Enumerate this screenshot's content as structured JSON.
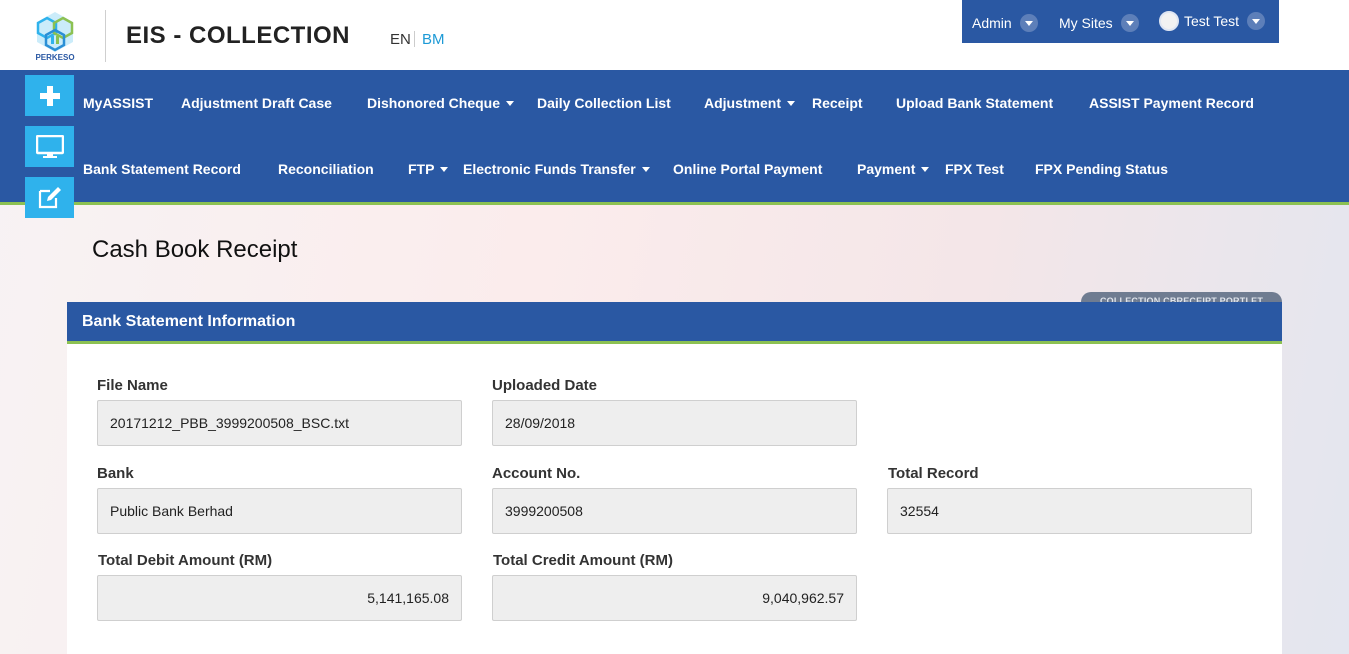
{
  "header": {
    "logo_text": "PERKESO",
    "app_title": "EIS - COLLECTION",
    "lang_en": "EN",
    "lang_bm": "BM"
  },
  "topbar": {
    "admin": "Admin",
    "my_sites": "My Sites",
    "user": "Test Test"
  },
  "nav": {
    "row1": [
      {
        "label": "MyASSIST",
        "dropdown": false
      },
      {
        "label": "Adjustment Draft Case",
        "dropdown": false
      },
      {
        "label": "Dishonored Cheque",
        "dropdown": true
      },
      {
        "label": "Daily Collection List",
        "dropdown": false
      },
      {
        "label": "Adjustment",
        "dropdown": true
      },
      {
        "label": "Receipt",
        "dropdown": false
      },
      {
        "label": "Upload Bank Statement",
        "dropdown": false
      },
      {
        "label": "ASSIST Payment Record",
        "dropdown": false
      }
    ],
    "row2": [
      {
        "label": "Bank Statement Record",
        "dropdown": false
      },
      {
        "label": "Reconciliation",
        "dropdown": false
      },
      {
        "label": "FTP",
        "dropdown": true
      },
      {
        "label": "Electronic Funds Transfer",
        "dropdown": true
      },
      {
        "label": "Online Portal Payment",
        "dropdown": false
      },
      {
        "label": "Payment",
        "dropdown": true
      },
      {
        "label": "FPX Test",
        "dropdown": false
      },
      {
        "label": "FPX Pending Status",
        "dropdown": false
      }
    ]
  },
  "side_buttons": [
    "plus-icon",
    "desktop-icon",
    "edit-icon"
  ],
  "page": {
    "title": "Cash Book Receipt",
    "portlet_tag": "COLLECTION CBRECEIPT PORTLET"
  },
  "panel": {
    "title": "Bank Statement Information",
    "fields": {
      "file_name": {
        "label": "File Name",
        "value": "20171212_PBB_3999200508_BSC.txt"
      },
      "uploaded_date": {
        "label": "Uploaded Date",
        "value": "28/09/2018"
      },
      "bank": {
        "label": "Bank",
        "value": "Public Bank Berhad"
      },
      "account_no": {
        "label": "Account No.",
        "value": "3999200508"
      },
      "total_record": {
        "label": "Total Record",
        "value": "32554"
      },
      "total_debit": {
        "label": "Total Debit Amount (RM)",
        "value": "5,141,165.08"
      },
      "total_credit": {
        "label": "Total Credit Amount (RM)",
        "value": "9,040,962.57"
      }
    }
  },
  "colors": {
    "primary_blue": "#2a58a3",
    "accent_green": "#8cc152",
    "side_button_cyan": "#2fb2ec",
    "lang_bm_blue": "#1d9ad6"
  }
}
